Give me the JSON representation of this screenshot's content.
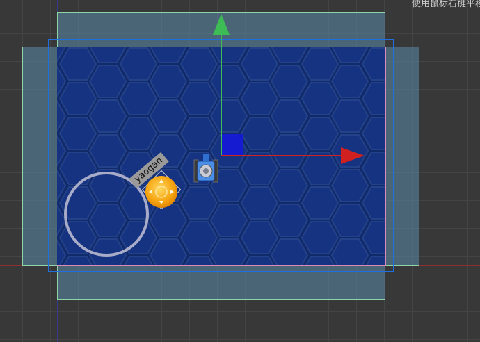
{
  "editor": {
    "hint_text": "使用鼠标右键平移",
    "node_label": "yaogan"
  },
  "colors": {
    "viewport_bg": "#383838",
    "scene_bg": "#102a6a",
    "hex_stroke": "#24428a",
    "gizmo_x": "#d02020",
    "gizmo_y": "#3dbb55",
    "gizmo_plane": "#1418d8",
    "frame_design": "#1f6fe0",
    "frame_safe": "#8fd4a8"
  },
  "icons": {
    "player": "tank-icon",
    "joystick_knob": "joystick-knob-icon"
  }
}
